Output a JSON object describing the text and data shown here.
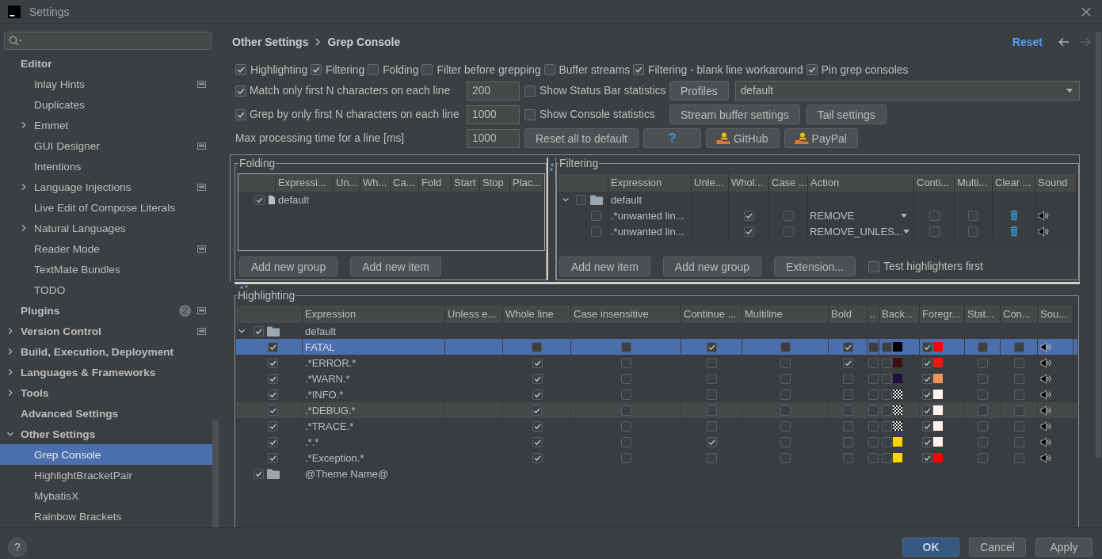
{
  "window": {
    "title": "Settings"
  },
  "sidebar": {
    "items": [
      {
        "label": "Editor",
        "selected": false,
        "project": false,
        "children": [
          {
            "label": "Inlay Hints",
            "selected": false,
            "project": true
          },
          {
            "label": "Duplicates",
            "selected": false,
            "project": false
          },
          {
            "label": "Emmet",
            "expanded": false,
            "selected": false,
            "project": false
          },
          {
            "label": "GUI Designer",
            "selected": false,
            "project": true
          },
          {
            "label": "Intentions",
            "selected": false,
            "project": false
          },
          {
            "label": "Language Injections",
            "expanded": false,
            "selected": false,
            "project": true
          },
          {
            "label": "Live Edit of Compose Literals",
            "selected": false,
            "project": false
          },
          {
            "label": "Natural Languages",
            "expanded": false,
            "selected": false,
            "project": false
          },
          {
            "label": "Reader Mode",
            "selected": false,
            "project": true
          },
          {
            "label": "TextMate Bundles",
            "selected": false,
            "project": false
          },
          {
            "label": "TODO",
            "selected": false,
            "project": false
          }
        ]
      },
      {
        "label": "Plugins",
        "badge": "2",
        "selected": false,
        "project": true
      },
      {
        "label": "Version Control",
        "expanded": false,
        "selected": false,
        "project": true
      },
      {
        "label": "Build, Execution, Deployment",
        "expanded": false,
        "selected": false,
        "project": false
      },
      {
        "label": "Languages & Frameworks",
        "expanded": false,
        "selected": false,
        "project": false
      },
      {
        "label": "Tools",
        "expanded": false,
        "selected": false,
        "project": false
      },
      {
        "label": "Advanced Settings",
        "selected": false,
        "project": false
      },
      {
        "label": "Other Settings",
        "expanded": true,
        "selected": false,
        "project": false,
        "children": [
          {
            "label": "Grep Console",
            "selected": true,
            "project": false
          },
          {
            "label": "HighlightBracketPair",
            "selected": false,
            "project": false
          },
          {
            "label": "MybatisX",
            "selected": false,
            "project": false
          },
          {
            "label": "Rainbow Brackets",
            "selected": false,
            "project": false
          }
        ]
      }
    ]
  },
  "breadcrumb": [
    "Other Settings",
    "Grep Console"
  ],
  "reset": "Reset",
  "navigation": [
    {
      "kind": "back",
      "disabled": false
    },
    {
      "kind": "forward",
      "disabled": true
    }
  ],
  "options": [
    {
      "label": "Highlighting",
      "checked": true
    },
    {
      "label": "Filtering",
      "checked": true
    },
    {
      "label": "Folding",
      "checked": false
    },
    {
      "label": "Filter before grepping",
      "checked": false
    },
    {
      "label": "Buffer streams",
      "checked": false
    },
    {
      "label": "Filtering - blank line workaround",
      "checked": true
    },
    {
      "label": "Pin grep consoles",
      "checked": true
    }
  ],
  "limits": [
    {
      "kind": "checkbox",
      "label": "Match only first N characters on each line",
      "checked": true,
      "value": "200"
    },
    {
      "kind": "checkbox",
      "label": "Grep by only first N characters on each line",
      "checked": true,
      "value": "1000"
    },
    {
      "kind": "text",
      "label": "Max processing time for a line [ms]",
      "value": "1000"
    }
  ],
  "statistics": [
    {
      "label": "Show Status Bar statistics",
      "checked": false
    },
    {
      "label": "Show Console statistics",
      "checked": false
    }
  ],
  "profiles": {
    "button": "Profiles",
    "selected_profile": "default"
  },
  "buffer_buttons": [
    "Stream buffer settings",
    "Tail settings"
  ],
  "action_buttons": [
    {
      "kind": "plain",
      "label": "Reset all to default"
    },
    {
      "kind": "help",
      "label": "?"
    },
    {
      "kind": "donate",
      "label": "GitHub"
    },
    {
      "kind": "donate",
      "label": "PayPal"
    }
  ],
  "folding": {
    "title": "Folding",
    "columns": [
      "Expressi...",
      "Un...",
      "Wh...",
      "Ca...",
      "Fold",
      "Start",
      "Stop",
      "Plac..."
    ],
    "rows": [
      {
        "enabled": true,
        "expression": "default"
      }
    ],
    "buttons": [
      "Add new group",
      "Add new item"
    ]
  },
  "filtering": {
    "title": "Filtering",
    "columns": [
      "Expression",
      "Unle...",
      "Whol...",
      "Case ...",
      "Action",
      "Conti...",
      "Multi...",
      "Clear ...",
      "Sound"
    ],
    "groups": [
      {
        "name": "default",
        "expanded": true,
        "checked": false,
        "rows": [
          {
            "enabled": false,
            "expression": ".*unwanted lin...",
            "column_4": true,
            "column_5": false,
            "action": "REMOVE",
            "column_7": false,
            "column_8": false
          },
          {
            "enabled": false,
            "expression": ".*unwanted lin...",
            "column_4": true,
            "column_5": false,
            "action": "REMOVE_UNLES...",
            "column_7": false,
            "column_8": false
          }
        ]
      }
    ],
    "buttons": [
      "Add new item",
      "Add new group",
      "Extension..."
    ],
    "test_first": {
      "label": "Test highlighters first",
      "checked": false
    }
  },
  "highlighting": {
    "title": "Highlighting",
    "columns": [
      "Expression",
      "Unless e...",
      "Whole line",
      "Case insensitive",
      "Continue ...",
      "Multiline",
      "Bold",
      "..",
      "Back...",
      "Foregr...",
      "Stat...",
      "Con...",
      "Sou..."
    ],
    "groups": [
      {
        "name": "default",
        "expanded": true,
        "checked": true,
        "rows": [
          {
            "enabled": true,
            "expression": "FATAL",
            "whole_line": false,
            "case_insensitive": false,
            "column_6": true,
            "multiline": false,
            "bold": true,
            "column_9": false,
            "column_10": {
              "checked": false,
              "color": "#000000"
            },
            "column_11": {
              "checked": true,
              "color": "#ff0000"
            },
            "column_12": false,
            "column_13": false,
            "selected": true,
            "hovered": false
          },
          {
            "enabled": true,
            "expression": ".*ERROR.*",
            "whole_line": true,
            "case_insensitive": false,
            "column_6": false,
            "multiline": false,
            "bold": true,
            "column_9": false,
            "column_10": {
              "checked": false,
              "color": "#3c1010"
            },
            "column_11": {
              "checked": true,
              "color": "#e8190e"
            },
            "column_12": false,
            "column_13": false,
            "selected": false,
            "hovered": false
          },
          {
            "enabled": true,
            "expression": ".*WARN.*",
            "whole_line": true,
            "case_insensitive": false,
            "column_6": false,
            "multiline": false,
            "bold": false,
            "column_9": false,
            "column_10": {
              "checked": false,
              "color": "#22103c"
            },
            "column_11": {
              "checked": true,
              "color": "#f0935a"
            },
            "column_12": false,
            "column_13": false,
            "selected": false,
            "hovered": false
          },
          {
            "enabled": true,
            "expression": ".*INFO.*",
            "whole_line": true,
            "case_insensitive": false,
            "column_6": false,
            "multiline": false,
            "bold": false,
            "column_9": false,
            "column_10": {
              "checked": false
            },
            "column_11": {
              "checked": true,
              "color": "#fff2ee"
            },
            "column_12": false,
            "column_13": false,
            "selected": false,
            "hovered": false
          },
          {
            "enabled": true,
            "expression": ".*DEBUG.*",
            "whole_line": true,
            "case_insensitive": false,
            "column_6": false,
            "multiline": false,
            "bold": false,
            "column_9": false,
            "column_10": {
              "checked": false
            },
            "column_11": {
              "checked": true,
              "color": "#fff2ee"
            },
            "column_12": false,
            "column_13": false,
            "selected": false,
            "hovered": true
          },
          {
            "enabled": true,
            "expression": ".*TRACE.*",
            "whole_line": true,
            "case_insensitive": false,
            "column_6": false,
            "multiline": false,
            "bold": false,
            "column_9": false,
            "column_10": {
              "checked": false
            },
            "column_11": {
              "checked": true,
              "color": "#fff2ee"
            },
            "column_12": false,
            "column_13": false,
            "selected": false,
            "hovered": false
          },
          {
            "enabled": true,
            "expression": ".*.*",
            "whole_line": true,
            "case_insensitive": false,
            "column_6": true,
            "multiline": false,
            "bold": false,
            "column_9": false,
            "column_10": {
              "checked": false,
              "color": "#ffd700"
            },
            "column_11": {
              "checked": true,
              "color": "#fff2ee"
            },
            "column_12": false,
            "column_13": false,
            "selected": false,
            "hovered": false
          },
          {
            "enabled": true,
            "expression": ".*Exception.*",
            "whole_line": true,
            "case_insensitive": false,
            "column_6": false,
            "multiline": false,
            "bold": false,
            "column_9": false,
            "column_10": {
              "checked": false,
              "color": "#ffd700"
            },
            "column_11": {
              "checked": true,
              "color": "#ff0000"
            },
            "column_12": false,
            "column_13": false,
            "selected": false,
            "hovered": false
          }
        ]
      },
      {
        "name": "@Theme Name@",
        "checked": true
      }
    ]
  },
  "footer": {
    "help": "?",
    "buttons": [
      {
        "kind": "primary",
        "label": "OK"
      },
      {
        "kind": "normal",
        "label": "Cancel"
      },
      {
        "kind": "normal",
        "label": "Apply"
      }
    ]
  }
}
